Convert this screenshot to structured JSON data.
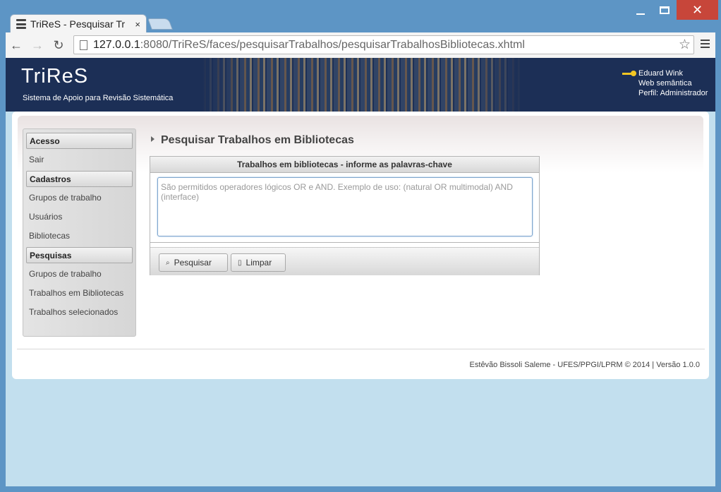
{
  "browser": {
    "tab_title": "TriReS - Pesquisar Tr",
    "tab_close": "×",
    "url_host": "127.0.0.1",
    "url_rest": ":8080/TriReS/faces/pesquisarTrabalhos/pesquisarTrabalhosBibliotecas.xhtml",
    "back": "←",
    "forward": "→",
    "reload": "↻",
    "star": "☆",
    "close": "✕"
  },
  "header": {
    "logo": "TriReS",
    "tagline": "Sistema de Apoio para Revisão Sistemática",
    "user_name": "Eduard Wink",
    "group": "Web semântica",
    "profile": "Perfil: Administrador"
  },
  "sidebar": {
    "sections": [
      {
        "header": "Acesso",
        "items": [
          "Sair"
        ]
      },
      {
        "header": "Cadastros",
        "items": [
          "Grupos de trabalho",
          "Usuários",
          "Bibliotecas"
        ]
      },
      {
        "header": "Pesquisas",
        "items": [
          "Grupos de trabalho",
          "Trabalhos em Bibliotecas",
          "Trabalhos selecionados"
        ]
      }
    ]
  },
  "main": {
    "page_title": "Pesquisar Trabalhos em Bibliotecas",
    "form_header": "Trabalhos em bibliotecas - informe as palavras-chave",
    "keywords_placeholder": "São permitidos operadores lógicos OR e AND. Exemplo de uso: (natural OR multimodal) AND (interface)",
    "keywords_value": "",
    "search_label": "Pesquisar",
    "clear_label": "Limpar"
  },
  "footer": {
    "text": "Estêvão Bissoli Saleme - UFES/PPGI/LPRM © 2014 | Versão 1.0.0"
  }
}
